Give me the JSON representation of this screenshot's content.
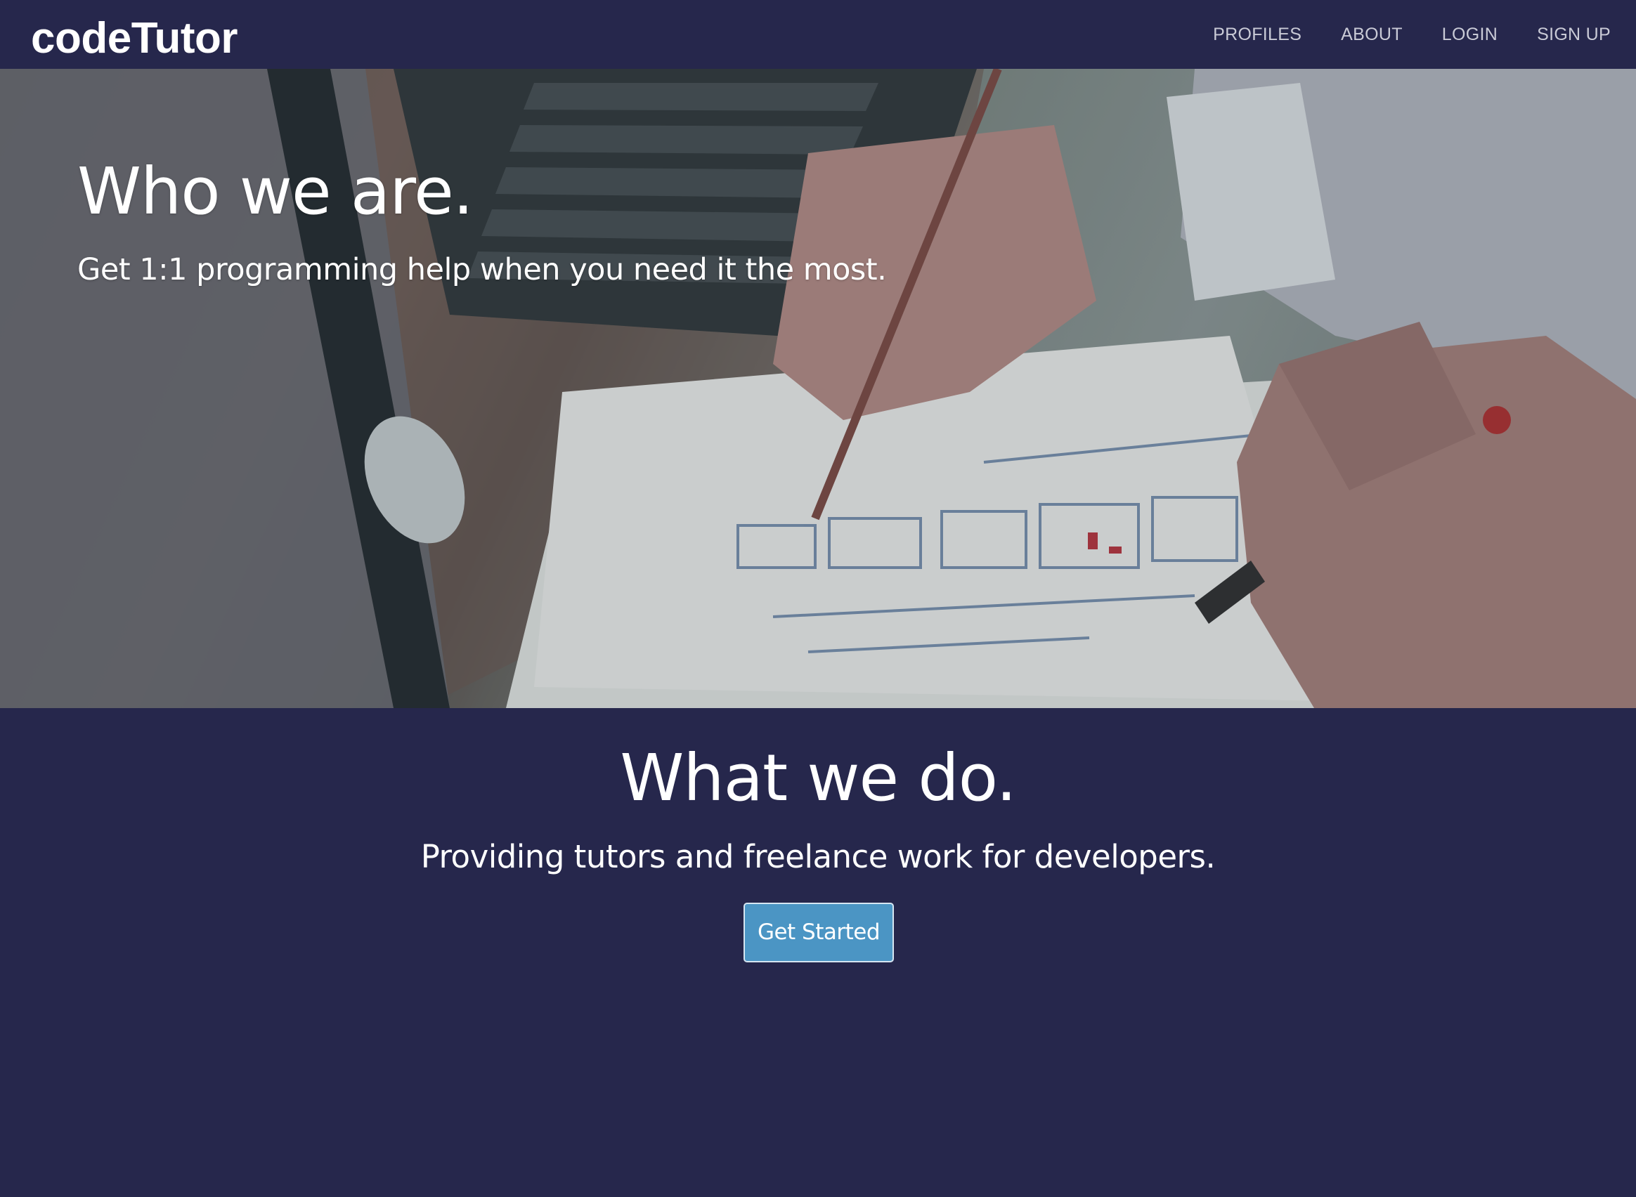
{
  "navbar": {
    "brand": "codeTutor",
    "links": [
      {
        "label": "PROFILES"
      },
      {
        "label": "ABOUT"
      },
      {
        "label": "LOGIN"
      },
      {
        "label": "SIGN UP"
      }
    ]
  },
  "hero": {
    "title": "Who we are.",
    "subtitle": "Get 1:1 programming help when you need it the most."
  },
  "about": {
    "title": "What we do.",
    "subtitle": "Providing tutors and freelance work for developers.",
    "cta_label": "Get Started"
  },
  "colors": {
    "background": "#26274c",
    "button": "#4b95c4",
    "nav_text": "#c9cad6",
    "text": "#ffffff"
  }
}
